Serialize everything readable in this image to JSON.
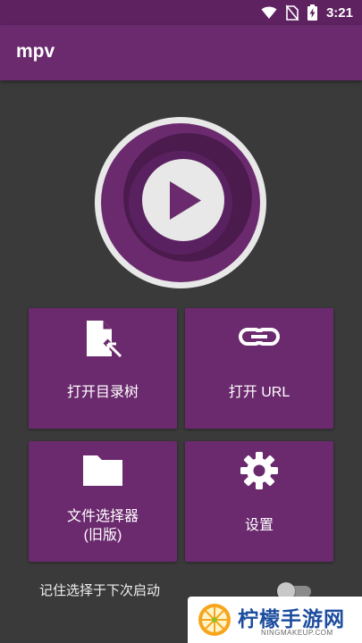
{
  "status_bar": {
    "time": "3:21",
    "icons": [
      "wifi-icon",
      "no-sim-icon",
      "battery-charging-icon"
    ]
  },
  "app_bar": {
    "title": "mpv"
  },
  "logo": {
    "icon": "play-icon"
  },
  "tiles": [
    {
      "label": "打开目录树",
      "icon": "file-open-icon"
    },
    {
      "label": "打开 URL",
      "icon": "link-icon"
    },
    {
      "label_line1": "文件选择器",
      "label_line2": "(旧版)",
      "icon": "folder-icon"
    },
    {
      "label": "设置",
      "icon": "settings-gear-icon"
    }
  ],
  "remember_choice": {
    "label": "记住选择于下次启动",
    "enabled": false
  },
  "watermark": {
    "text": "柠檬手游网",
    "sub": "NINGMAKEUP.COM"
  },
  "colors": {
    "primary": "#6b2a6e",
    "primary_dark": "#5e2261",
    "background": "#3a3a3a",
    "accent_text": "#ffffff"
  }
}
